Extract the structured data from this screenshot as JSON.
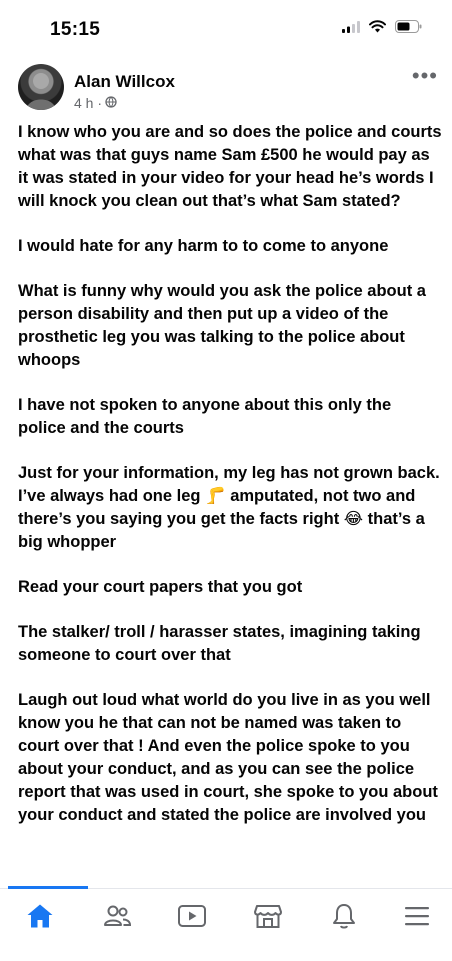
{
  "status_bar": {
    "time": "15:15"
  },
  "post": {
    "author": "Alan Willcox",
    "time_ago": "4 h ·",
    "paragraphs": [
      "I know who you are  and so does the police and courts  what was that guys name Sam £500 he would pay as it was stated in your video for your head he’s words I will knock you clean out that’s what Sam stated?",
      "I would hate for any harm to to come to anyone",
      "What is funny why would you ask the police about a person disability and then put up a video of the prosthetic leg you was talking to the police about whoops",
      "I have not spoken to anyone about this only the police and the courts",
      null,
      "Read your court papers that you got",
      "The stalker/ troll / harasser states, imagining taking someone to court over that",
      "Laugh out loud what world do you live in as you well know  you he that can not be named was taken to court over that ! And even the police spoke to you about your conduct, and as you can see the  police report that was used in court, she spoke to you about your conduct and stated the police are involved  you"
    ],
    "leg_paragraph": {
      "part1": "Just for your information, my leg has not grown back. I’ve always had one leg ",
      "emoji1": "🦵",
      "part2": "  amputated, not two  and there’s you saying you get the facts right ",
      "emoji2": "😂",
      "part3": " that’s a big whopper"
    }
  },
  "icons": {
    "signal": "signal-icon",
    "wifi": "wifi-icon",
    "battery": "battery-icon",
    "privacy": "globe-icon",
    "more": "more-horizontal-icon",
    "nav": [
      "home-icon",
      "friends-icon",
      "video-icon",
      "marketplace-icon",
      "notifications-icon",
      "menu-icon"
    ]
  },
  "colors": {
    "accent": "#1877f2",
    "text": "#050505",
    "secondary_text": "#65676b",
    "nav_icon": "#65676b"
  }
}
